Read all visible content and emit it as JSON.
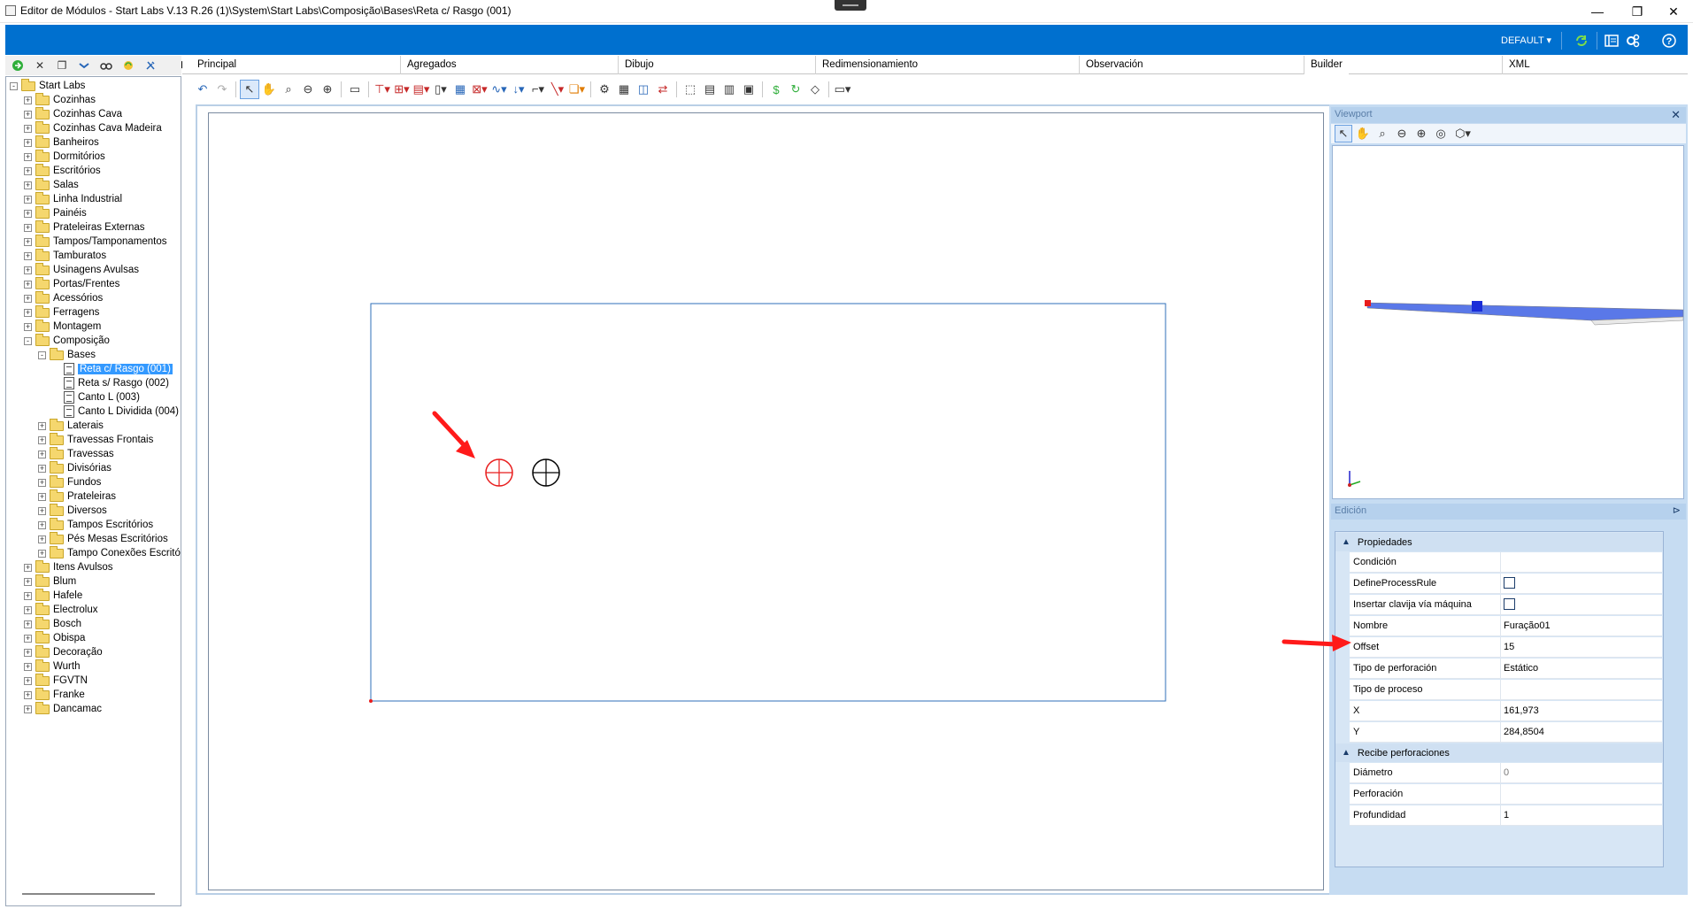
{
  "window": {
    "title": "Editor de Módulos - Start Labs V.13 R.26 (1)\\System\\Start Labs\\Composição\\Bases\\Reta c/ Rasgo (001)",
    "minimize_glyph": "—",
    "maximize_glyph": "❐",
    "close_glyph": "✕"
  },
  "header": {
    "profile_label": "DEFAULT ▾",
    "icons": [
      "refresh-icon",
      "layout-icon",
      "settings-icon",
      "help-icon"
    ]
  },
  "sidebar": {
    "toolbar_icons": [
      "add-icon",
      "delete-icon",
      "copy-icon",
      "move-icon",
      "find-icon",
      "refresh-tree-icon",
      "tools-icon"
    ],
    "root": "Start Labs",
    "items": [
      "Cozinhas",
      "Cozinhas Cava",
      "Cozinhas Cava Madeira",
      "Banheiros",
      "Dormitórios",
      "Escritórios",
      "Salas",
      "Linha Industrial",
      "Painéis",
      "Prateleiras Externas",
      "Tampos/Tamponamentos",
      "Tamburatos",
      "Usinagens Avulsas",
      "Portas/Frentes",
      "Acessórios",
      "Ferragens",
      "Montagem"
    ],
    "composicao": "Composição",
    "bases": "Bases",
    "base_items": [
      "Reta c/ Rasgo (001)",
      "Reta s/ Rasgo (002)",
      "Canto L (003)",
      "Canto L Dividida (004)"
    ],
    "composicao_items": [
      "Laterais",
      "Travessas Frontais",
      "Travessas",
      "Divisórias",
      "Fundos",
      "Prateleiras",
      "Diversos",
      "Tampos Escritórios",
      "Pés Mesas Escritórios",
      "Tampo Conexões Escritórios"
    ],
    "after_items": [
      "Itens Avulsos",
      "Blum",
      "Hafele",
      "Electrolux",
      "Bosch",
      "Obispa",
      "Decoração",
      "Wurth",
      "FGVTN",
      "Franke",
      "Dancamac"
    ]
  },
  "tabs": [
    "Principal",
    "Agregados",
    "Dibujo",
    "Redimensionamiento",
    "Observación",
    "Builder",
    "XML"
  ],
  "viewport": {
    "title": "Viewport",
    "close": "✕"
  },
  "edicion": {
    "title": "Edición",
    "pin": "⊳",
    "propiedades": {
      "label": "Propiedades",
      "rows": [
        {
          "name": "Condición",
          "value": ""
        },
        {
          "name": "DefineProcessRule",
          "value": ""
        },
        {
          "name": "Insertar clavija vía máquina",
          "value": ""
        },
        {
          "name": "Nombre",
          "value": "Furação01"
        },
        {
          "name": "Offset",
          "value": "15"
        },
        {
          "name": "Tipo de perforación",
          "value": "Estático"
        },
        {
          "name": "Tipo de proceso",
          "value": ""
        },
        {
          "name": "X",
          "value": "161,973"
        },
        {
          "name": "Y",
          "value": "284,8504"
        }
      ]
    },
    "recibe": {
      "label": "Recibe perforaciones",
      "rows": [
        {
          "name": "Diámetro",
          "value": "0"
        },
        {
          "name": "Perforación",
          "value": ""
        },
        {
          "name": "Profundidad",
          "value": "1"
        }
      ]
    }
  },
  "colors": {
    "accent_blue": "#0070cf",
    "annotation_red": "#ff1a1a",
    "hole_selected": "#e81c1c"
  }
}
